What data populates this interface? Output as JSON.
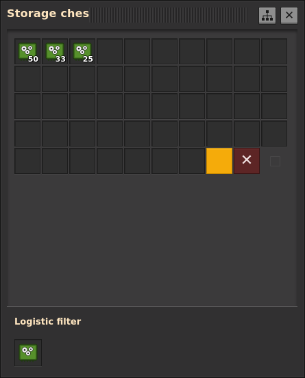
{
  "window": {
    "title": "Storage chest"
  },
  "inventory": {
    "slots": [
      {
        "item": "logistic-chip-icon",
        "count": "50"
      },
      {
        "item": "logistic-chip-icon",
        "count": "33"
      },
      {
        "item": "logistic-chip-icon",
        "count": "25"
      }
    ],
    "limit_marker": "inventory-limit",
    "clear_icon": "close-icon"
  },
  "logistic_filter": {
    "label": "Logistic filter",
    "item": "logistic-chip-icon"
  },
  "colors": {
    "accent_limit": "#f5ab0a",
    "clear_button": "#5d2525",
    "title_text": "#ffe6c0"
  }
}
